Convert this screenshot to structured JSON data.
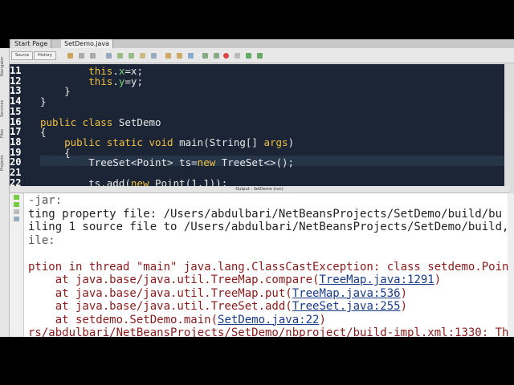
{
  "tabs": [
    "Start Page",
    "SetDemo.java"
  ],
  "toolbar": {
    "source": "Source",
    "history": "History"
  },
  "sidebar": [
    "Navigator",
    "Services",
    "Files",
    "Projects"
  ],
  "editor": {
    "line_numbers": [
      "11",
      "12",
      "13",
      "14",
      "15",
      "16",
      "17",
      "18",
      "19",
      "20",
      "21",
      "22"
    ],
    "lines": [
      {
        "parts": [
          [
            "",
            "        "
          ],
          [
            "kw",
            "this"
          ],
          [
            "",
            "."
          ],
          [
            "fld",
            "x"
          ],
          [
            "",
            "=x;"
          ]
        ]
      },
      {
        "parts": [
          [
            "",
            "        "
          ],
          [
            "kw",
            "this"
          ],
          [
            "",
            "."
          ],
          [
            "fld",
            "y"
          ],
          [
            "",
            "=y;"
          ]
        ]
      },
      {
        "parts": [
          [
            "",
            "    }"
          ]
        ]
      },
      {
        "parts": [
          [
            "",
            "}"
          ]
        ]
      },
      {
        "parts": [
          [
            "",
            ""
          ]
        ]
      },
      {
        "parts": [
          [
            "kw",
            "public class"
          ],
          [
            "",
            " SetDemo"
          ]
        ]
      },
      {
        "parts": [
          [
            "",
            "{"
          ]
        ]
      },
      {
        "parts": [
          [
            "kw",
            "    public static void"
          ],
          [
            "",
            " main(String[] "
          ],
          [
            "kw",
            "args"
          ],
          [
            "",
            ")"
          ]
        ]
      },
      {
        "parts": [
          [
            "",
            "    {"
          ]
        ]
      },
      {
        "parts": [
          [
            "",
            "        TreeSet<Point> ts="
          ],
          [
            "kw",
            "new"
          ],
          [
            "",
            " TreeSet<>();"
          ]
        ]
      },
      {
        "parts": [
          [
            "",
            ""
          ]
        ]
      },
      {
        "parts": [
          [
            "",
            "        ts.add("
          ],
          [
            "kw",
            "new"
          ],
          [
            "",
            " Point(1,1));"
          ]
        ]
      }
    ]
  },
  "output": {
    "title": "Output - SetDemo (run)",
    "lines": [
      {
        "cls": "gray",
        "text": "-jar:"
      },
      {
        "cls": "",
        "text": "ting property file: /Users/abdulbari/NetBeansProjects/SetDemo/build/bu"
      },
      {
        "cls": "",
        "text": "iling 1 source file to /Users/abdulbari/NetBeansProjects/SetDemo/build,"
      },
      {
        "cls": "gray",
        "text": "ile:"
      },
      {
        "cls": "",
        "text": ""
      },
      {
        "cls": "red",
        "text": "ption in thread \"main\" java.lang.ClassCastException: class setdemo.Poin"
      },
      {
        "cls": "red",
        "text": "    at java.base/java.util.TreeMap.compare(",
        "link": "TreeMap.java:1291",
        "after": ")"
      },
      {
        "cls": "red",
        "text": "    at java.base/java.util.TreeMap.put(",
        "link": "TreeMap.java:536",
        "after": ")"
      },
      {
        "cls": "red",
        "text": "    at java.base/java.util.TreeSet.add(",
        "link": "TreeSet.java:255",
        "after": ")"
      },
      {
        "cls": "red",
        "text": "    at setdemo.SetDemo.main(",
        "link": "SetDemo.java:22",
        "after": ")"
      },
      {
        "cls": "red",
        "text": "rs/abdulbari/NetBeansProjects/SetDemo/nbproject/build-impl.xml:1330: Th"
      }
    ]
  }
}
